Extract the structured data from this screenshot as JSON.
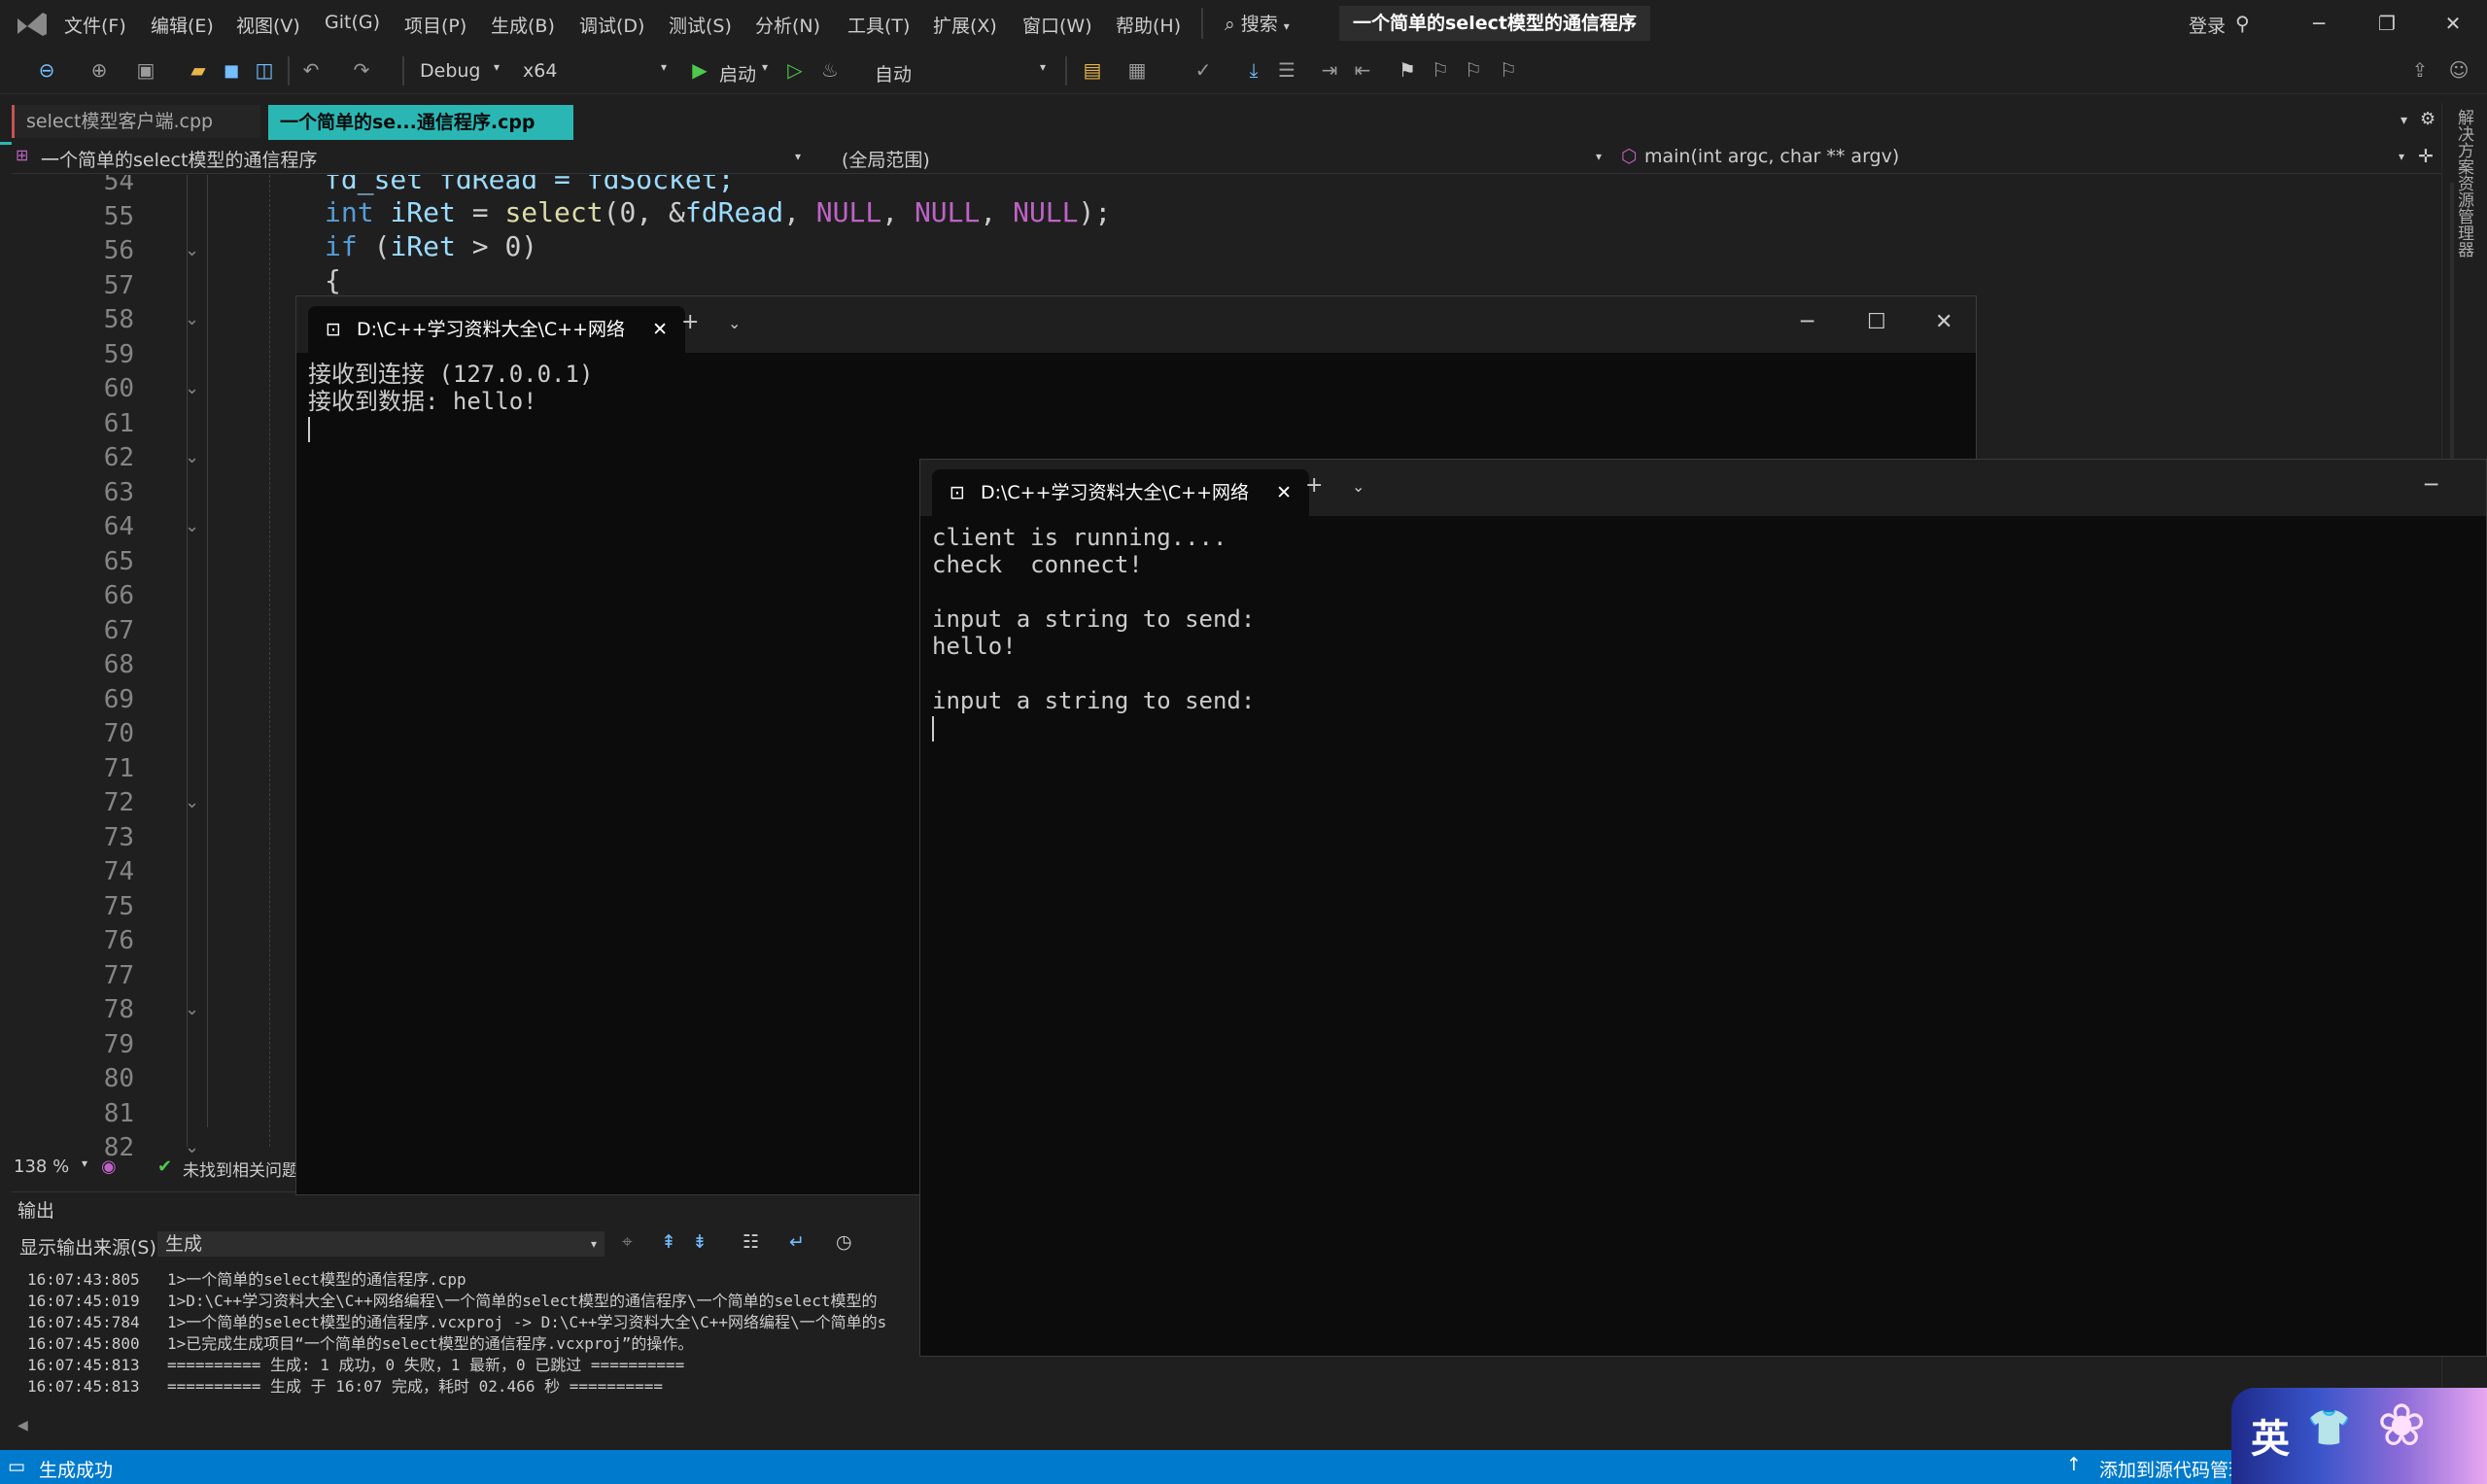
{
  "menu": {
    "items": [
      "文件(F)",
      "编辑(E)",
      "视图(V)",
      "Git(G)",
      "项目(P)",
      "生成(B)",
      "调试(D)",
      "测试(S)",
      "分析(N)",
      "工具(T)",
      "扩展(X)",
      "窗口(W)",
      "帮助(H)"
    ],
    "search": "搜索",
    "solution_title": "一个简单的select模型的通信程序",
    "login": "登录"
  },
  "toolbar": {
    "config": "Debug",
    "platform": "x64",
    "start": "启动",
    "mode": "自动"
  },
  "doc_tabs": [
    "select模型客户端.cpp",
    "一个简单的se...通信程序.cpp"
  ],
  "navbar": {
    "project": "一个简单的select模型的通信程序",
    "scope": "(全局范围)",
    "member": "main(int argc, char ** argv)"
  },
  "side_panel": {
    "label": "解决方案资源管理器"
  },
  "editor": {
    "line_numbers": [
      "54",
      "55",
      "56",
      "57",
      "58",
      "59",
      "60",
      "61",
      "62",
      "63",
      "64",
      "65",
      "66",
      "67",
      "68",
      "69",
      "70",
      "71",
      "72",
      "73",
      "74",
      "75",
      "76",
      "77",
      "78",
      "79",
      "80",
      "81",
      "82"
    ],
    "line54": "fd_set fdRead = fdSocket;",
    "line55": {
      "kw": "int",
      "var": "iRet",
      "op1": " = ",
      "fn": "select",
      "args": "(0, &",
      "var2": "fdRead",
      "sep": ", ",
      "m1": "NULL",
      "m2": "NULL",
      "m3": "NULL",
      "end": ");"
    },
    "line56": {
      "kw": "if",
      "rest1": " (",
      "var": "iRet",
      "rest2": " > 0)"
    },
    "line57": "{",
    "zoom": "138 %",
    "status_text": "未找到相关问题"
  },
  "terminal_server": {
    "tab_title": "D:\\C++学习资料大全\\C++网络",
    "lines": [
      "接收到连接 (127.0.0.1)",
      "接收到数据: hello!"
    ]
  },
  "terminal_client": {
    "tab_title": "D:\\C++学习资料大全\\C++网络",
    "lines": [
      "client is running....",
      "check  connect!",
      "",
      "input a string to send:",
      "hello!",
      "",
      "input a string to send:"
    ]
  },
  "output": {
    "title": "输出",
    "source_label": "显示输出来源(S):",
    "source_value": "生成",
    "lines": [
      {
        "time": "16:07:43:805",
        "text": "1>一个简单的select模型的通信程序.cpp"
      },
      {
        "time": "16:07:45:019",
        "text": "1>D:\\C++学习资料大全\\C++网络编程\\一个简单的select模型的通信程序\\一个简单的select模型的"
      },
      {
        "time": "16:07:45:784",
        "text": "1>一个简单的select模型的通信程序.vcxproj -> D:\\C++学习资料大全\\C++网络编程\\一个简单的s"
      },
      {
        "time": "16:07:45:800",
        "text": "1>已完成生成项目“一个简单的select模型的通信程序.vcxproj”的操作。"
      },
      {
        "time": "16:07:45:813",
        "text": "========== 生成: 1 成功，0 失败，1 最新，0 已跳过 =========="
      },
      {
        "time": "16:07:45:813",
        "text": "========== 生成 于 16:07 完成，耗时 02.466 秒 =========="
      }
    ]
  },
  "statusbar": {
    "left": "生成成功",
    "right": "添加到源代码管理"
  },
  "ime": {
    "label": "英"
  },
  "colors": {
    "accent": "#2ab7b4",
    "statusbar": "#007acc",
    "keyword": "#569cd6",
    "function": "#dcdcaa",
    "variable": "#9cdcfe",
    "macro": "#bd63c5"
  },
  "icons": [
    "vs-logo-icon",
    "back-icon",
    "forward-icon",
    "save-icon",
    "save-all-icon",
    "undo-icon",
    "redo-icon",
    "play-icon",
    "play-outline-icon",
    "bookmark-icon",
    "terminal-icon",
    "close-icon",
    "plus-icon",
    "chevron-down-icon",
    "minimize-icon",
    "maximize-icon",
    "check-circle-icon",
    "clock-icon",
    "arrow-up-icon"
  ]
}
